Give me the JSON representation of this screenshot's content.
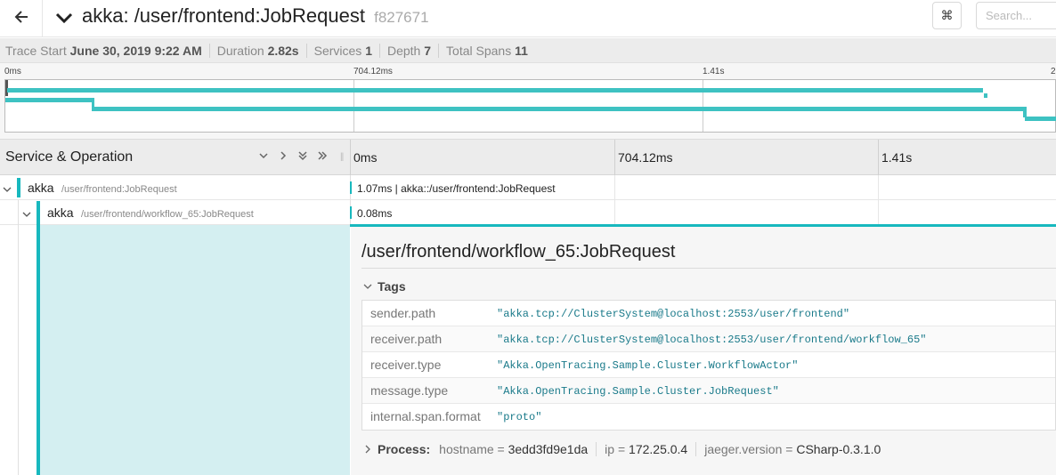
{
  "header": {
    "title": "akka: /user/frontend:JobRequest",
    "trace_id": "f827671",
    "kbd_icon": "⌘",
    "search_placeholder": "Search..."
  },
  "summary": {
    "trace_start_label": "Trace Start",
    "trace_start_value": "June 30, 2019 9:22 AM",
    "duration_label": "Duration",
    "duration_value": "2.82s",
    "services_label": "Services",
    "services_value": "1",
    "depth_label": "Depth",
    "depth_value": "7",
    "total_spans_label": "Total Spans",
    "total_spans_value": "11"
  },
  "minimap": {
    "ticks": [
      "0ms",
      "704.12ms",
      "1.41s",
      "2"
    ]
  },
  "columns": {
    "service_operation": "Service & Operation",
    "ticks": [
      "0ms",
      "704.12ms",
      "1.41s"
    ]
  },
  "rows": [
    {
      "service": "akka",
      "operation": "/user/frontend:JobRequest",
      "span_label": "1.07ms | akka::/user/frontend:JobRequest"
    },
    {
      "service": "akka",
      "operation": "/user/frontend/workflow_65:JobRequest",
      "span_label": "0.08ms"
    }
  ],
  "detail": {
    "title": "/user/frontend/workflow_65:JobRequest",
    "tags_label": "Tags",
    "tags": [
      {
        "key": "sender.path",
        "value": "\"akka.tcp://ClusterSystem@localhost:2553/user/frontend\""
      },
      {
        "key": "receiver.path",
        "value": "\"akka.tcp://ClusterSystem@localhost:2553/user/frontend/workflow_65\""
      },
      {
        "key": "receiver.type",
        "value": "\"Akka.OpenTracing.Sample.Cluster.WorkflowActor\""
      },
      {
        "key": "message.type",
        "value": "\"Akka.OpenTracing.Sample.Cluster.JobRequest\""
      },
      {
        "key": "internal.span.format",
        "value": "\"proto\""
      }
    ],
    "process_label": "Process:",
    "process": [
      {
        "key": "hostname",
        "value": "3edd3fd9e1da"
      },
      {
        "key": "ip",
        "value": "172.25.0.4"
      },
      {
        "key": "jaeger.version",
        "value": "CSharp-0.3.1.0"
      }
    ]
  },
  "colors": {
    "accent": "#17b8be",
    "minimap_bar": "#3ec2c2",
    "detail_bg": "#d4eff1"
  }
}
